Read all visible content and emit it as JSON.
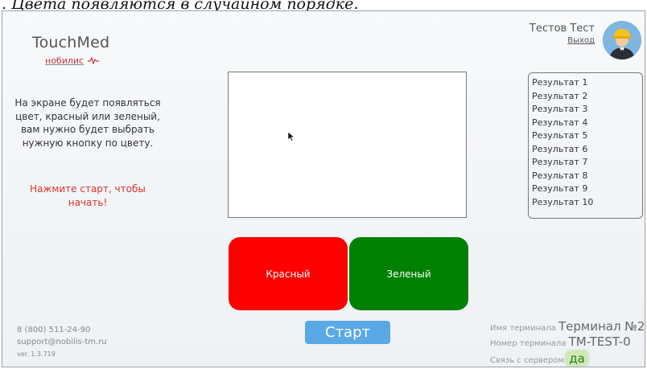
{
  "caption": ". Цвета появляются в случайном порядке.",
  "logo": {
    "brand": "TouchMed",
    "sub": "нобилис"
  },
  "instructions": "На экране будет появляться цвет, красный или зеленый, вам нужно будет выбрать нужную кнопку по цвету.",
  "cta": "Нажмите старт, чтобы начать!",
  "buttons": {
    "red": "Красный",
    "green": "Зеленый",
    "start": "Старт"
  },
  "user": {
    "name": "Тестов Тест",
    "logout": "Выход"
  },
  "results": [
    "Результат 1",
    "Результат 2",
    "Результат 3",
    "Результат 4",
    "Результат 5",
    "Результат 6",
    "Результат 7",
    "Результат 8",
    "Результат 9",
    "Результат 10"
  ],
  "contact": {
    "phone": "8 (800) 511-24-90",
    "email": "support@nobilis-tm.ru",
    "version": "ver. 1.3.719"
  },
  "terminal": {
    "name_label": "Имя терминала",
    "name_value": "Терминал №2",
    "number_label": "Номер терминала",
    "number_value": "TM-TEST-0",
    "server_label": "Связь с сервером",
    "server_value": "да"
  },
  "colors": {
    "red": "#ff0000",
    "green": "#008000",
    "start": "#5aa9e6",
    "cta": "#e0302a"
  },
  "icons": {
    "avatar": "worker-hardhat-icon",
    "cursor": "mouse-pointer-icon",
    "pulse": "heartbeat-icon"
  }
}
